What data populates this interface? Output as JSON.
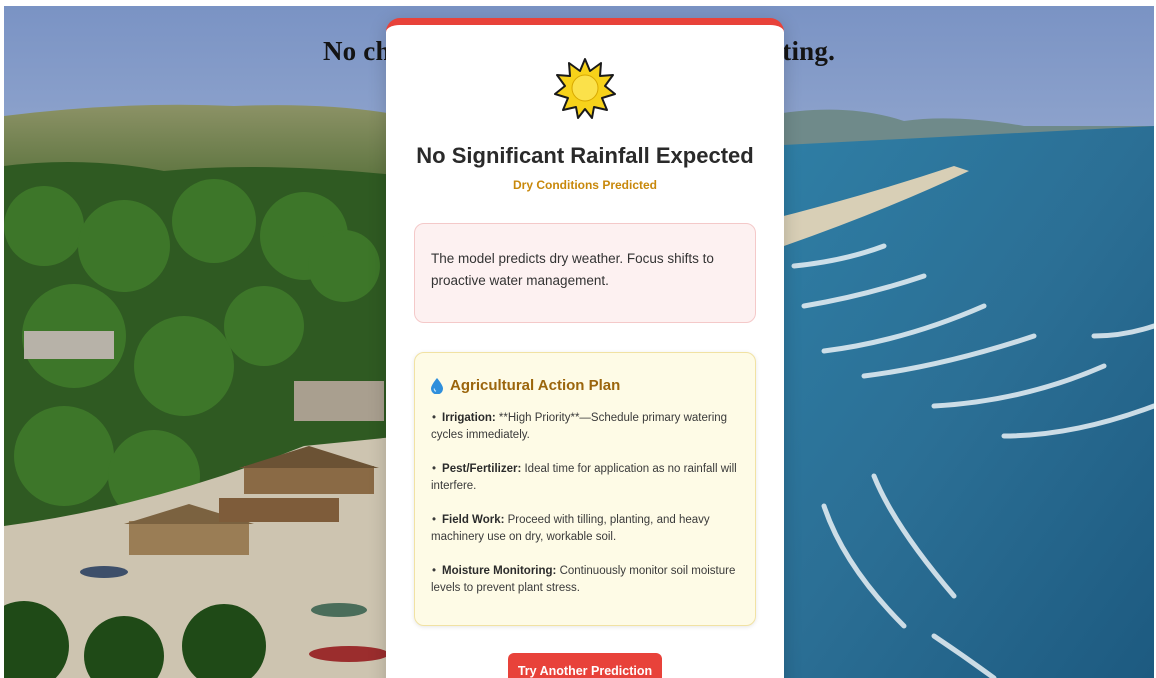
{
  "page": {
    "headline": "No chances of rain hence enjoy your outing."
  },
  "card": {
    "accent_color": "#e8423a",
    "icon": "sun-icon",
    "title": "No Significant Rainfall Expected",
    "subtitle": "Dry Conditions Predicted",
    "summary": "The model predicts dry weather. Focus shifts to proactive water management.",
    "plan": {
      "icon": "water-drop-icon",
      "title": "Agricultural Action Plan",
      "items": [
        {
          "label": "Irrigation:",
          "text": " **High Priority**—Schedule primary watering cycles immediately."
        },
        {
          "label": "Pest/Fertilizer:",
          "text": " Ideal time for application as no rainfall will interfere."
        },
        {
          "label": "Field Work:",
          "text": " Proceed with tilling, planting, and heavy machinery use on dry, workable soil."
        },
        {
          "label": "Moisture Monitoring:",
          "text": " Continuously monitor soil moisture levels to prevent plant stress."
        }
      ]
    },
    "button_label": "Try Another Prediction"
  }
}
